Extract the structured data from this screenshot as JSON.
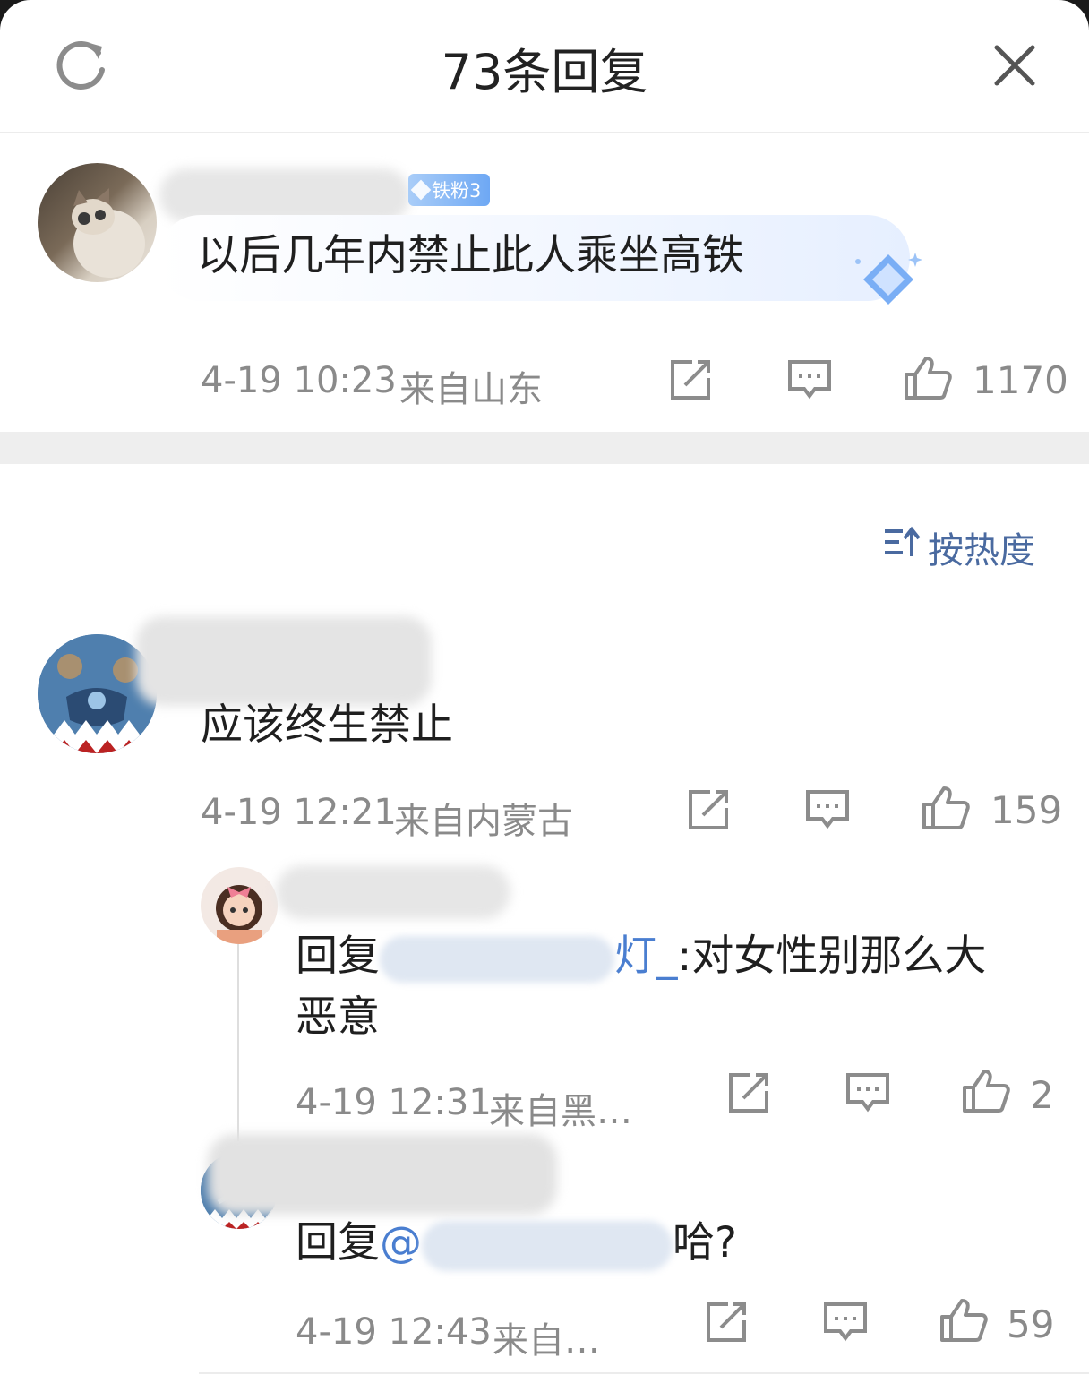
{
  "header": {
    "title": "73条回复"
  },
  "root_comment": {
    "badge": "铁粉3",
    "content": "以后几年内禁止此人乘坐高铁",
    "time": "4-19 10:23",
    "location": "来自山东",
    "likes": "1170"
  },
  "sort": {
    "label": "按热度"
  },
  "replies": [
    {
      "content": "应该终生禁止",
      "time": "4-19 12:21",
      "location": "来自内蒙古",
      "likes": "159"
    },
    {
      "content_prefix": "回复",
      "mention_suffix": "灯_",
      "content_rest": ":对女性别那么大",
      "content_line2": "恶意",
      "time": "4-19 12:31",
      "location": "来自黑…",
      "likes": "2"
    },
    {
      "content_prefix": "回复",
      "mention_prefix": "@",
      "content_rest": "哈?",
      "time": "4-19 12:43",
      "location": "来自…",
      "likes": "59"
    }
  ],
  "icons": [
    "refresh-icon",
    "close-icon",
    "share-icon",
    "comment-icon",
    "like-icon",
    "sort-icon",
    "diamond-icon"
  ],
  "colors": {
    "link": "#4a7ed0",
    "meta": "#8a8a8a",
    "badge": "#6ea8f4",
    "sort": "#4a6aa0"
  }
}
